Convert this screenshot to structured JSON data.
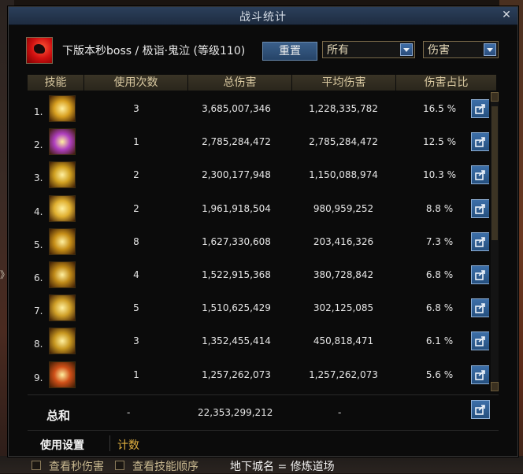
{
  "window": {
    "title": "战斗统计",
    "close_glyph": "✕"
  },
  "header": {
    "boss_name": "下版本秒boss / 极诣·鬼泣 (等级110)",
    "reset_label": "重置",
    "filter_select": "所有",
    "metric_select": "伤害"
  },
  "columns": [
    "技能",
    "使用次数",
    "总伤害",
    "平均伤害",
    "伤害占比"
  ],
  "rows": [
    {
      "rank": "1.",
      "count": "3",
      "total": "3,685,007,346",
      "avg": "1,228,335,782",
      "pct": "16.5 %",
      "icon_color": "#d8a020"
    },
    {
      "rank": "2.",
      "count": "1",
      "total": "2,785,284,472",
      "avg": "2,785,284,472",
      "pct": "12.5 %",
      "icon_color": "#b040c0"
    },
    {
      "rank": "3.",
      "count": "2",
      "total": "2,300,177,948",
      "avg": "1,150,088,974",
      "pct": "10.3 %",
      "icon_color": "#d0a020"
    },
    {
      "rank": "4.",
      "count": "2",
      "total": "1,961,918,504",
      "avg": "980,959,252",
      "pct": "8.8 %",
      "icon_color": "#e0b030"
    },
    {
      "rank": "5.",
      "count": "8",
      "total": "1,627,330,608",
      "avg": "203,416,326",
      "pct": "7.3 %",
      "icon_color": "#c89018"
    },
    {
      "rank": "6.",
      "count": "4",
      "total": "1,522,915,368",
      "avg": "380,728,842",
      "pct": "6.8 %",
      "icon_color": "#c08a18"
    },
    {
      "rank": "7.",
      "count": "5",
      "total": "1,510,625,429",
      "avg": "302,125,085",
      "pct": "6.8 %",
      "icon_color": "#d0a028"
    },
    {
      "rank": "8.",
      "count": "3",
      "total": "1,352,455,414",
      "avg": "450,818,471",
      "pct": "6.1 %",
      "icon_color": "#c89820"
    },
    {
      "rank": "9.",
      "count": "1",
      "total": "1,257,262,073",
      "avg": "1,257,262,073",
      "pct": "5.6 %",
      "icon_color": "#d05018"
    }
  ],
  "total": {
    "label": "总和",
    "count": "-",
    "value": "22,353,299,212",
    "avg": "-"
  },
  "tabs": {
    "settings": "使用设置",
    "count": "计数"
  },
  "footer": {
    "view_second_damage": "查看秒伤害",
    "view_skill_order": "查看技能顺序",
    "dungeon": "地下城名 = 修炼道场"
  },
  "background": {
    "left_fragment": "》bo"
  }
}
